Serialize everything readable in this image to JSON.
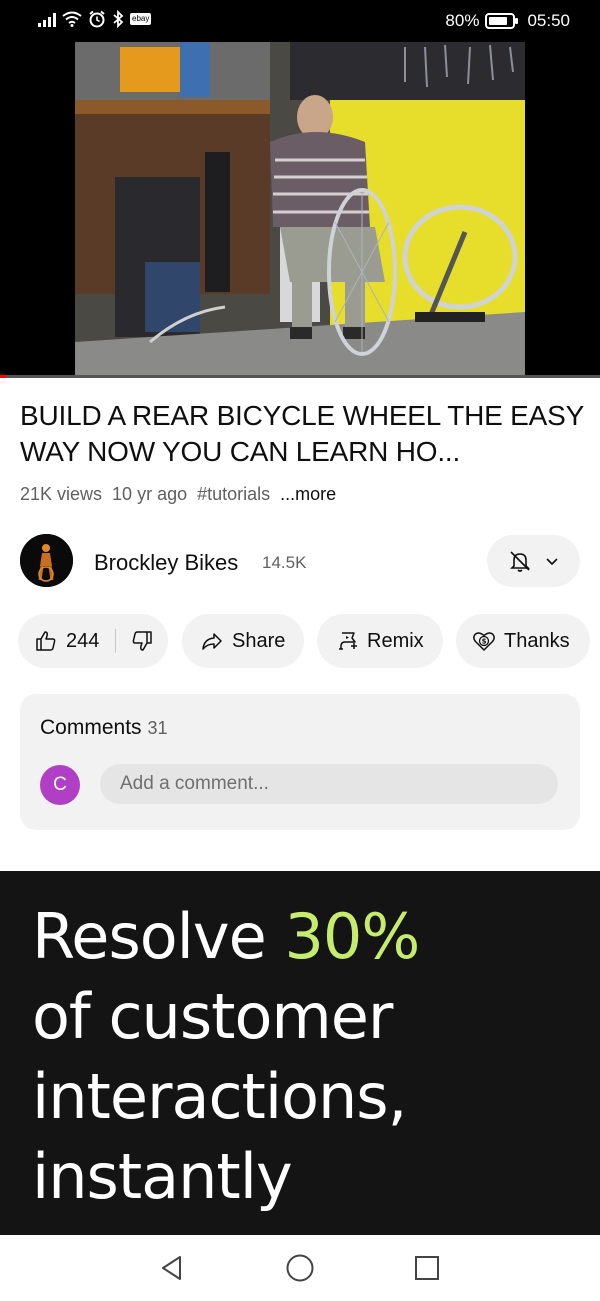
{
  "status_bar": {
    "battery_percent": "80%",
    "battery_level": 0.8,
    "time": "05:50",
    "notification_badge": "ebay"
  },
  "video": {
    "progress": 0.01,
    "progress_color": "#ff0000",
    "title": "BUILD A REAR BICYCLE WHEEL THE EASY WAY NOW YOU CAN LEARN HO...",
    "views": "21K views",
    "age": "10 yr ago",
    "hashtag": "#tutorials",
    "more_label": "...more"
  },
  "channel": {
    "name": "Brockley Bikes",
    "subscribers": "14.5K"
  },
  "actions": {
    "like_count": "244",
    "share_label": "Share",
    "remix_label": "Remix",
    "thanks_label": "Thanks"
  },
  "comments": {
    "label": "Comments",
    "count": "31",
    "user_initial": "C",
    "placeholder": "Add a comment..."
  },
  "ad": {
    "line1_prefix": "Resolve",
    "line1_accent": "30%",
    "line2": "of customer",
    "line3": "interactions,",
    "line4": "instantly",
    "accent_color": "#c6ec6e"
  },
  "icons": {
    "status": [
      "signal-icon",
      "wifi-icon",
      "alarm-icon",
      "bluetooth-icon",
      "ebay-notification-icon",
      "battery-icon"
    ],
    "actions": [
      "thumb-up-icon",
      "thumb-down-icon",
      "share-icon",
      "remix-icon",
      "thanks-icon",
      "bell-off-icon",
      "chevron-down-icon"
    ],
    "nav": [
      "back-icon",
      "home-icon",
      "recents-icon"
    ]
  }
}
